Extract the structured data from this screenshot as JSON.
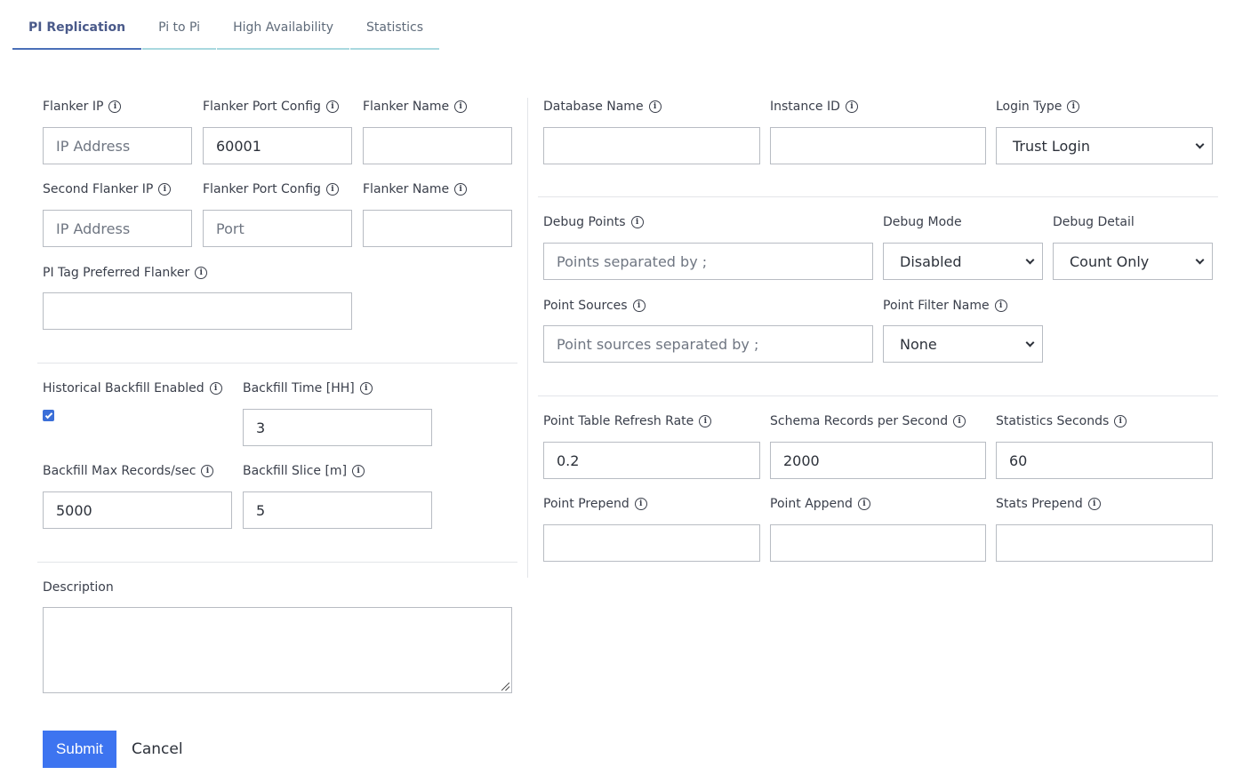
{
  "tabs": [
    {
      "label": "PI Replication",
      "active": true
    },
    {
      "label": "Pi to Pi",
      "active": false
    },
    {
      "label": "High Availability",
      "active": false
    },
    {
      "label": "Statistics",
      "active": false
    }
  ],
  "info_glyph": "i",
  "left": {
    "flanker_ip": {
      "label": "Flanker IP",
      "placeholder": "IP Address",
      "value": ""
    },
    "flanker_port_config": {
      "label": "Flanker Port Config",
      "value": "60001"
    },
    "flanker_name": {
      "label": "Flanker Name",
      "value": ""
    },
    "second_flanker_ip": {
      "label": "Second Flanker IP",
      "placeholder": "IP Address",
      "value": ""
    },
    "second_flanker_port_config": {
      "label": "Flanker Port Config",
      "placeholder": "Port",
      "value": ""
    },
    "second_flanker_name": {
      "label": "Flanker Name",
      "value": ""
    },
    "pi_tag_preferred_flanker": {
      "label": "PI Tag Preferred Flanker",
      "value": ""
    },
    "historical_backfill_enabled": {
      "label": "Historical Backfill Enabled",
      "checked": true
    },
    "backfill_time": {
      "label": "Backfill Time [HH]",
      "value": "3"
    },
    "backfill_max_records": {
      "label": "Backfill Max Records/sec",
      "value": "5000"
    },
    "backfill_slice": {
      "label": "Backfill Slice [m]",
      "value": "5"
    },
    "description": {
      "label": "Description",
      "value": ""
    }
  },
  "right": {
    "database_name": {
      "label": "Database Name",
      "value": ""
    },
    "instance_id": {
      "label": "Instance ID",
      "value": ""
    },
    "login_type": {
      "label": "Login Type",
      "value": "Trust Login"
    },
    "debug_points": {
      "label": "Debug Points",
      "placeholder": "Points separated by ;"
    },
    "debug_mode": {
      "label": "Debug Mode",
      "value": "Disabled"
    },
    "debug_detail": {
      "label": "Debug Detail",
      "value": "Count Only"
    },
    "point_sources": {
      "label": "Point Sources",
      "placeholder": "Point sources separated by ;"
    },
    "point_filter_name": {
      "label": "Point Filter Name",
      "value": "None"
    },
    "point_table_refresh_rate": {
      "label": "Point Table Refresh Rate",
      "value": "0.2"
    },
    "schema_records_per_second": {
      "label": "Schema Records per Second",
      "value": "2000"
    },
    "statistics_seconds": {
      "label": "Statistics Seconds",
      "value": "60"
    },
    "point_prepend": {
      "label": "Point Prepend",
      "value": ""
    },
    "point_append": {
      "label": "Point Append",
      "value": ""
    },
    "stats_prepend": {
      "label": "Stats Prepend",
      "value": ""
    }
  },
  "actions": {
    "submit_label": "Submit",
    "cancel_label": "Cancel"
  },
  "colors": {
    "primary": "#3d74f0",
    "tab_active": "#4a6fb8",
    "tab_underline": "#a9d8df",
    "checkbox": "#3b6fd8"
  }
}
